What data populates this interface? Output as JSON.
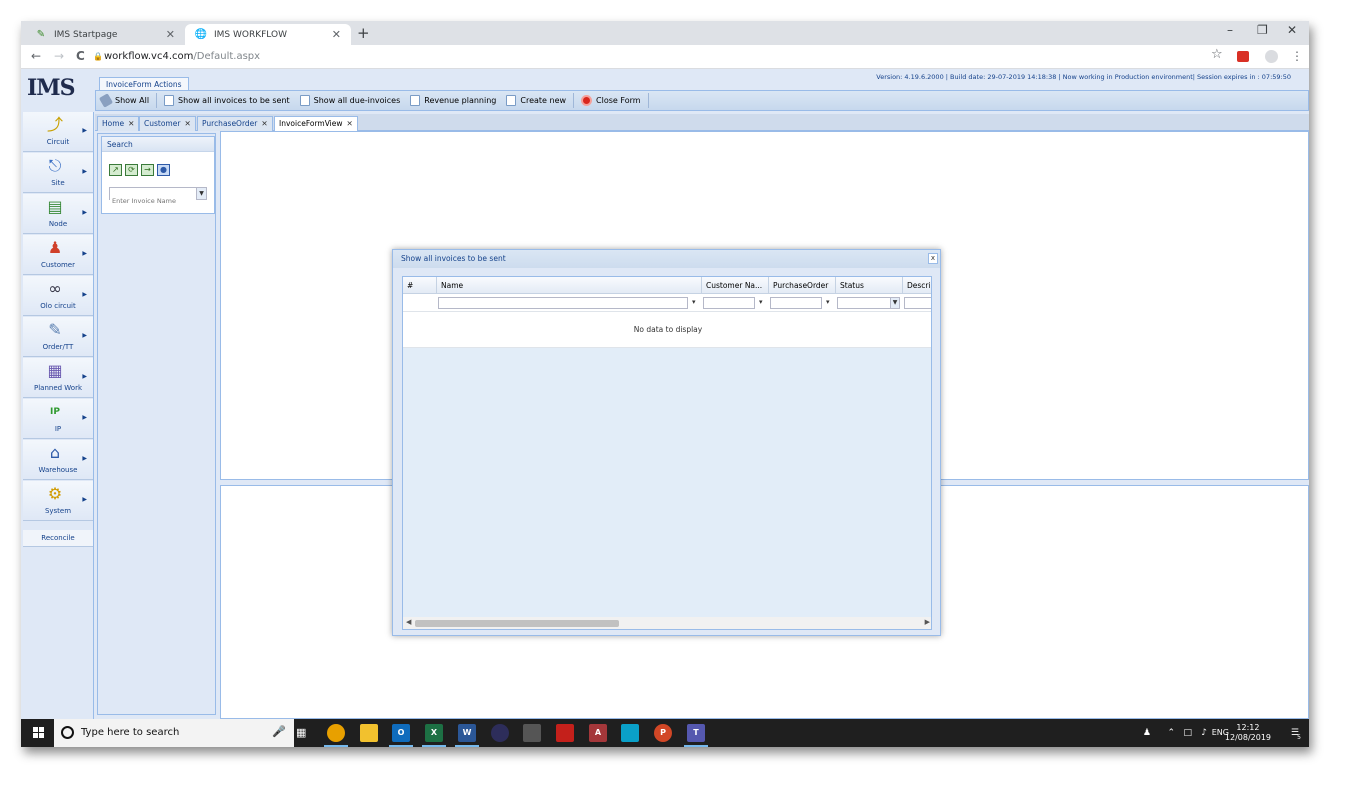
{
  "browser": {
    "tabs": [
      {
        "title": "IMS Startpage",
        "active": false
      },
      {
        "title": "IMS WORKFLOW",
        "active": true
      }
    ],
    "url_host": "workflow.vc4.com",
    "url_path": "/Default.aspx",
    "new_tab": "+",
    "close_glyph": "✕",
    "win_min": "–",
    "win_max": "❐",
    "win_close": "✕",
    "back": "←",
    "forward": "→",
    "reload": "C",
    "star": "☆",
    "menu": "⋮"
  },
  "app": {
    "logo": "IMS",
    "version_line": "Version: 4.19.6.2000 | Build date: 29-07-2019 14:18:38 | Now working in Production environment| Session expires in : 07:59:50",
    "actions_tab": "InvoiceForm Actions",
    "toolbar": {
      "show_all": "Show All",
      "show_all_invoices_to_be_sent": "Show all invoices to be sent",
      "show_all_due_invoices": "Show all due-invoices",
      "revenue_planning": "Revenue planning",
      "create_new": "Create new",
      "close_form": "Close Form"
    },
    "nav": [
      {
        "label": "Circuit",
        "icon": "circuit-icon"
      },
      {
        "label": "Site",
        "icon": "site-icon"
      },
      {
        "label": "Node",
        "icon": "node-icon"
      },
      {
        "label": "Customer",
        "icon": "customer-icon"
      },
      {
        "label": "Olo circuit",
        "icon": "olo-circuit-icon"
      },
      {
        "label": "Order/TT",
        "icon": "order-icon"
      },
      {
        "label": "Planned Work",
        "icon": "calendar-icon"
      },
      {
        "label": "IP",
        "icon": "ip-icon"
      },
      {
        "label": "Warehouse",
        "icon": "warehouse-icon"
      },
      {
        "label": "System",
        "icon": "gear-icon"
      }
    ],
    "reconcile": "Reconcile",
    "doc_tabs": [
      {
        "label": "Home",
        "active": false
      },
      {
        "label": "Customer",
        "active": false
      },
      {
        "label": "PurchaseOrder",
        "active": false
      },
      {
        "label": "InvoiceFormView",
        "active": true
      }
    ],
    "search": {
      "title": "Search",
      "invoice_placeholder": "Enter Invoice Name"
    },
    "modal": {
      "title": "Show all invoices to be sent",
      "close": "x",
      "columns": [
        "#",
        "Name",
        "Customer Na...",
        "PurchaseOrder",
        "Status",
        "Descrip"
      ],
      "empty_text": "No data to display"
    }
  },
  "taskbar": {
    "search_placeholder": "Type here to search",
    "lang": "ENG",
    "time": "12:12",
    "date": "12/08/2019",
    "notifications": "5"
  },
  "colors": {
    "panel_bg": "#dfe8f6",
    "panel_border": "#99bbe8",
    "header_text": "#15428b"
  }
}
